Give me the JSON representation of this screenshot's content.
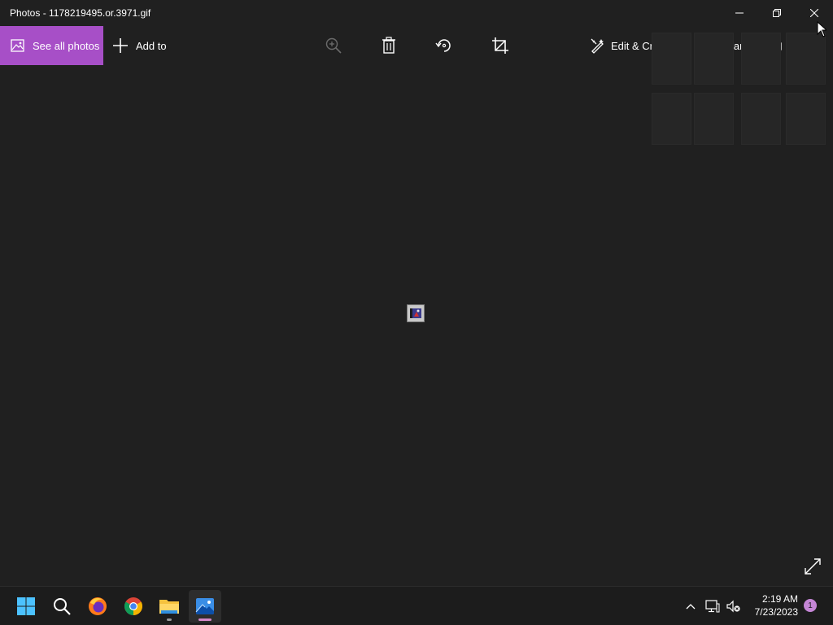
{
  "window": {
    "title": "Photos - 1178219495.or.3971.gif"
  },
  "toolbar": {
    "see_all_label": "See all photos",
    "add_to_label": "Add to",
    "edit_create_label": "Edit & Create",
    "share_label": "Share"
  },
  "taskbar": {
    "time": "2:19 AM",
    "date": "7/23/2023",
    "notification_count": "1"
  },
  "colors": {
    "accent": "#a74fc7",
    "background": "#202020",
    "taskbar": "#1c1c1c"
  },
  "icons": [
    "zoom-in-icon",
    "delete-icon",
    "rotate-icon",
    "crop-icon",
    "edit-create-icon",
    "share-icon",
    "print-icon",
    "more-icon",
    "expand-icon",
    "start-icon",
    "search-icon",
    "firefox-icon",
    "chrome-icon",
    "file-explorer-icon",
    "photos-icon"
  ]
}
